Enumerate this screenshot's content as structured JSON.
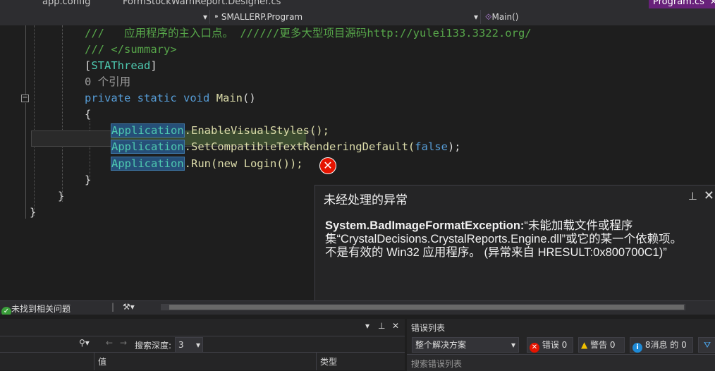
{
  "tabs": [
    {
      "label": "app.config"
    },
    {
      "label": "FormStockWarnReport.Designer.cs"
    },
    {
      "label": "Program.cs"
    }
  ],
  "navbar": {
    "project": "SMALLERP.Program",
    "member": "Main()"
  },
  "code": {
    "l1_comment": "///   应用程序的主入口点。 //////更多大型项目源码http://yulei133.3322.org/",
    "l2_comment": "/// </summary>",
    "l3_open": "[",
    "l3_attr": "STAThread",
    "l3_close": "]",
    "l4_refs": "0 个引用",
    "l5_kw1": "private",
    "l5_kw2": "static",
    "l5_kw3": "void",
    "l5_name": "Main",
    "l5_parens": "()",
    "l6": "{",
    "l7_type": "Application",
    "l7_rest": ".EnableVisualStyles();",
    "l8_type": "Application",
    "l8_method": ".SetCompatibleTextRenderingDefault(",
    "l8_kw": "false",
    "l8_end": ");",
    "l9_type": "Application",
    "l9_rest": ".Run(new Login());",
    "l10": "}",
    "l11": "}",
    "l12": "}"
  },
  "exception": {
    "title": "未经处理的异常",
    "type": "System.BadImageFormatException:",
    "line1": "“未能加载文件或程序",
    "line2": "集“CrystalDecisions.CrystalReports.Engine.dll”或它的某一个依赖项。",
    "line3": "不是有效的 Win32 应用程序。 (异常来自 HRESULT:0x800700C1)”",
    "close_glyph": "✕",
    "pin_glyph": "📌"
  },
  "status": {
    "issues": "未找到相关问题"
  },
  "locals_panel": {
    "search_depth_label": "搜索深度:",
    "search_depth_value": "3",
    "col_value": "值",
    "col_type": "类型"
  },
  "error_list": {
    "title": "错误列表",
    "scope": "整个解决方案",
    "errors": "错误 0",
    "warnings": "警告 0",
    "messages": "8消息 的 0",
    "search_placeholder": "搜索错误列表"
  },
  "colors": {
    "accent": "#68217a",
    "error": "#e51400",
    "warning": "#f0c000",
    "info": "#1e8ad6",
    "ok": "#3a9d3a"
  }
}
